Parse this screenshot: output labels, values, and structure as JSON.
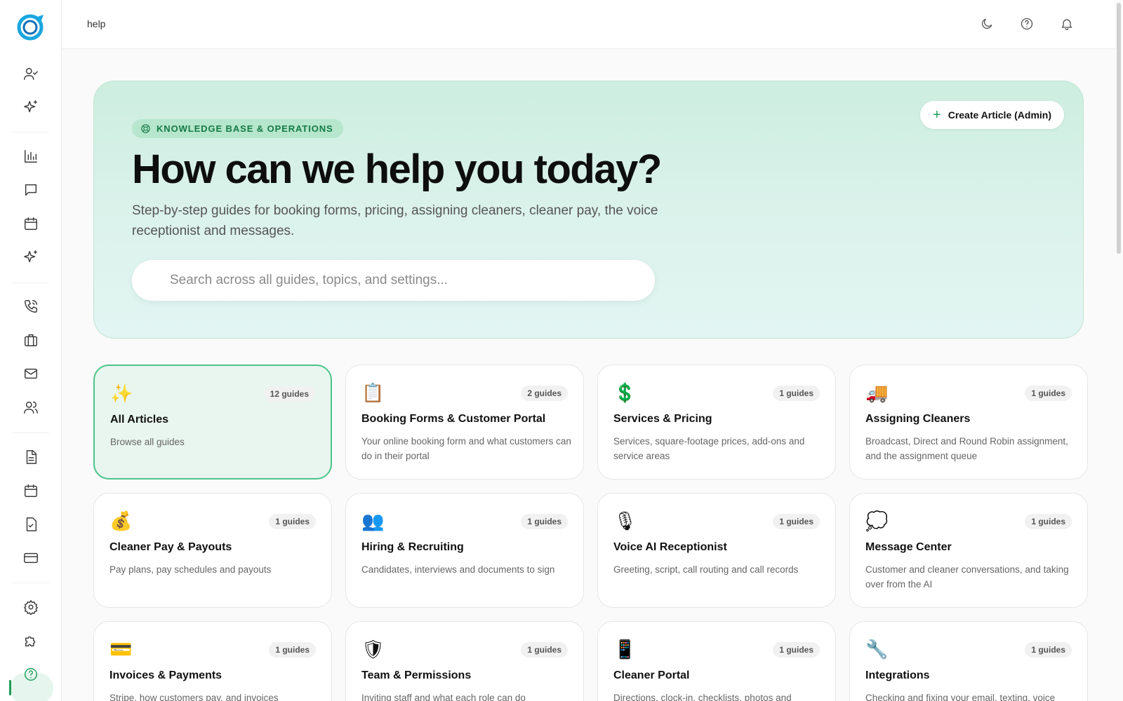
{
  "header": {
    "breadcrumb": "help",
    "icons": [
      "moon-icon",
      "question-circle-icon",
      "bell-icon"
    ]
  },
  "sidebar": {
    "icons": [
      "user-check-icon",
      "sparkles-icon",
      "bar-chart-icon",
      "chat-icon",
      "calendar-icon",
      "sparkles-icon",
      "phone-icon",
      "briefcase-icon",
      "mail-icon",
      "users-icon",
      "document-icon",
      "calendar-icon",
      "clipboard-check-icon",
      "credit-card-icon",
      "gear-icon",
      "puzzle-icon",
      "help-circle-icon"
    ],
    "active": "help-circle-icon"
  },
  "hero": {
    "badge": "KNOWLEDGE BASE & OPERATIONS",
    "title": "How can we help you today?",
    "subtitle": "Step-by-step guides for booking forms, pricing, assigning cleaners, cleaner pay, the voice receptionist and messages.",
    "search_placeholder": "Search across all guides, topics, and settings...",
    "create_label": "Create Article (Admin)"
  },
  "colors": {
    "accent": "#1f9d5c",
    "hero_bg": "#d6f1e6",
    "selected_border": "#4cc48a"
  },
  "categories": [
    {
      "emoji": "✨",
      "count": "12 guides",
      "title": "All Articles",
      "desc": "Browse all guides"
    },
    {
      "emoji": "📋",
      "count": "2 guides",
      "title": "Booking Forms & Customer Portal",
      "desc": "Your online booking form and what customers can do in their portal"
    },
    {
      "emoji": "💲",
      "count": "1 guides",
      "title": "Services & Pricing",
      "desc": "Services, square-footage prices, add-ons and service areas"
    },
    {
      "emoji": "🚚",
      "count": "1 guides",
      "title": "Assigning Cleaners",
      "desc": "Broadcast, Direct and Round Robin assignment, and the assignment queue"
    },
    {
      "emoji": "💰",
      "count": "1 guides",
      "title": "Cleaner Pay & Payouts",
      "desc": "Pay plans, pay schedules and payouts"
    },
    {
      "emoji": "👥",
      "count": "1 guides",
      "title": "Hiring & Recruiting",
      "desc": "Candidates, interviews and documents to sign"
    },
    {
      "emoji": "🎙",
      "count": "1 guides",
      "title": "Voice AI Receptionist",
      "desc": "Greeting, script, call routing and call records"
    },
    {
      "emoji": "💭",
      "count": "1 guides",
      "title": "Message Center",
      "desc": "Customer and cleaner conversations, and taking over from the AI"
    },
    {
      "emoji": "💳",
      "count": "1 guides",
      "title": "Invoices & Payments",
      "desc": "Stripe, how customers pay, and invoices"
    },
    {
      "emoji": "🛡",
      "count": "1 guides",
      "title": "Team & Permissions",
      "desc": "Inviting staff and what each role can do"
    },
    {
      "emoji": "📱",
      "count": "1 guides",
      "title": "Cleaner Portal",
      "desc": "Directions, clock-in, checklists, photos and"
    },
    {
      "emoji": "🔧",
      "count": "1 guides",
      "title": "Integrations",
      "desc": "Checking and fixing your email, texting, voice"
    }
  ]
}
